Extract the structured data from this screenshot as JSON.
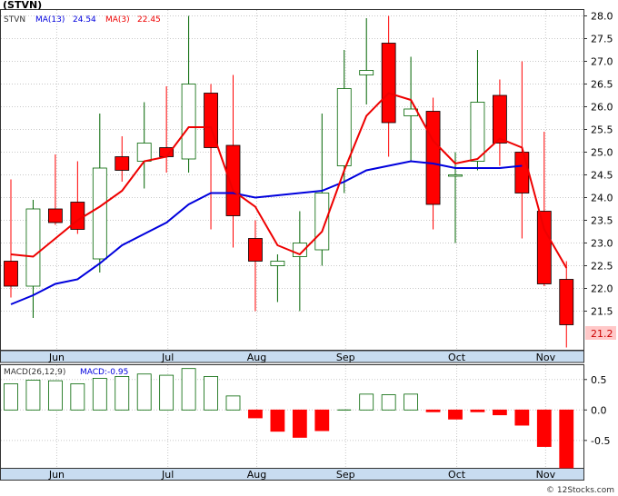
{
  "title": "(STVN)",
  "legend": {
    "symbol": "STVN",
    "ma13_label": "MA(13)",
    "ma13_value": "24.54",
    "ma3_label": "MA(3)",
    "ma3_value": "22.45"
  },
  "macd_legend": {
    "label": "MACD(26,12,9)",
    "value_label": "MACD:-0.95"
  },
  "last_price_label": "21.2",
  "watermark": "© 12Stocks.com",
  "colors": {
    "up": "#006400",
    "down": "#ff0000",
    "ma13": "#0000dd",
    "ma3": "#ee0000",
    "axis_band": "#c8dcf0",
    "price_tag": "#ffc8c8"
  },
  "chart_data": {
    "type": "candlestick",
    "price_axis": {
      "ticks": [
        "28.0",
        "27.5",
        "27.0",
        "26.5",
        "26.0",
        "25.5",
        "25.0",
        "24.5",
        "24.0",
        "23.5",
        "23.0",
        "22.5",
        "22.0",
        "21.5"
      ],
      "ylim": [
        20.65,
        28.15
      ]
    },
    "x_labels": [
      "Jun",
      "Jul",
      "Aug",
      "Sep",
      "Oct",
      "Nov"
    ],
    "x_label_index": [
      1,
      6,
      10,
      14,
      19,
      23
    ],
    "candles": [
      {
        "o": 22.6,
        "h": 24.4,
        "l": 21.8,
        "c": 22.05
      },
      {
        "o": 22.05,
        "h": 23.95,
        "l": 21.35,
        "c": 23.75
      },
      {
        "o": 23.75,
        "h": 24.95,
        "l": 23.4,
        "c": 23.45
      },
      {
        "o": 23.9,
        "h": 24.8,
        "l": 23.2,
        "c": 23.3
      },
      {
        "o": 22.65,
        "h": 25.85,
        "l": 22.35,
        "c": 24.65
      },
      {
        "o": 24.9,
        "h": 25.35,
        "l": 24.35,
        "c": 24.6
      },
      {
        "o": 24.8,
        "h": 26.1,
        "l": 24.2,
        "c": 25.2
      },
      {
        "o": 25.1,
        "h": 26.45,
        "l": 24.55,
        "c": 24.9
      },
      {
        "o": 24.85,
        "h": 28.0,
        "l": 24.55,
        "c": 26.5
      },
      {
        "o": 26.3,
        "h": 26.5,
        "l": 23.3,
        "c": 25.1
      },
      {
        "o": 25.15,
        "h": 26.7,
        "l": 22.9,
        "c": 23.6
      },
      {
        "o": 23.1,
        "h": 23.5,
        "l": 21.5,
        "c": 22.6
      },
      {
        "o": 22.5,
        "h": 22.75,
        "l": 21.7,
        "c": 22.6
      },
      {
        "o": 22.7,
        "h": 23.7,
        "l": 21.5,
        "c": 23.0
      },
      {
        "o": 22.85,
        "h": 25.85,
        "l": 22.5,
        "c": 24.1
      },
      {
        "o": 24.7,
        "h": 27.25,
        "l": 24.1,
        "c": 26.4
      },
      {
        "o": 26.7,
        "h": 27.95,
        "l": 26.05,
        "c": 26.8
      },
      {
        "o": 27.4,
        "h": 28.0,
        "l": 24.9,
        "c": 25.65
      },
      {
        "o": 25.8,
        "h": 27.1,
        "l": 24.8,
        "c": 25.95
      },
      {
        "o": 25.9,
        "h": 26.2,
        "l": 23.3,
        "c": 23.85
      },
      {
        "o": 24.5,
        "h": 25.0,
        "l": 23.0,
        "c": 24.5
      },
      {
        "o": 24.8,
        "h": 27.25,
        "l": 24.6,
        "c": 26.1
      },
      {
        "o": 26.25,
        "h": 26.6,
        "l": 24.7,
        "c": 25.2
      },
      {
        "o": 25.0,
        "h": 27.0,
        "l": 23.1,
        "c": 24.1
      },
      {
        "o": 23.7,
        "h": 25.45,
        "l": 22.05,
        "c": 22.1
      },
      {
        "o": 22.2,
        "h": 22.6,
        "l": 20.7,
        "c": 21.2
      }
    ],
    "ma13": [
      {
        "i": 0,
        "v": 21.65
      },
      {
        "i": 1,
        "v": 21.85
      },
      {
        "i": 2,
        "v": 22.1
      },
      {
        "i": 3,
        "v": 22.2
      },
      {
        "i": 4,
        "v": 22.55
      },
      {
        "i": 5,
        "v": 22.95
      },
      {
        "i": 6,
        "v": 23.2
      },
      {
        "i": 7,
        "v": 23.45
      },
      {
        "i": 8,
        "v": 23.85
      },
      {
        "i": 9,
        "v": 24.1
      },
      {
        "i": 10,
        "v": 24.1
      },
      {
        "i": 11,
        "v": 24.0
      },
      {
        "i": 12,
        "v": 24.05
      },
      {
        "i": 13,
        "v": 24.1
      },
      {
        "i": 14,
        "v": 24.15
      },
      {
        "i": 15,
        "v": 24.35
      },
      {
        "i": 16,
        "v": 24.6
      },
      {
        "i": 17,
        "v": 24.7
      },
      {
        "i": 18,
        "v": 24.8
      },
      {
        "i": 19,
        "v": 24.75
      },
      {
        "i": 20,
        "v": 24.65
      },
      {
        "i": 21,
        "v": 24.65
      },
      {
        "i": 22,
        "v": 24.65
      },
      {
        "i": 23,
        "v": 24.7
      }
    ],
    "ma3": [
      {
        "i": 0,
        "v": 22.75
      },
      {
        "i": 1,
        "v": 22.7
      },
      {
        "i": 2,
        "v": 23.1
      },
      {
        "i": 3,
        "v": 23.5
      },
      {
        "i": 4,
        "v": 23.8
      },
      {
        "i": 5,
        "v": 24.15
      },
      {
        "i": 6,
        "v": 24.8
      },
      {
        "i": 7,
        "v": 24.9
      },
      {
        "i": 8,
        "v": 25.55
      },
      {
        "i": 9,
        "v": 25.55
      },
      {
        "i": 10,
        "v": 24.15
      },
      {
        "i": 11,
        "v": 23.8
      },
      {
        "i": 12,
        "v": 22.95
      },
      {
        "i": 13,
        "v": 22.75
      },
      {
        "i": 14,
        "v": 23.25
      },
      {
        "i": 15,
        "v": 24.6
      },
      {
        "i": 16,
        "v": 25.8
      },
      {
        "i": 17,
        "v": 26.3
      },
      {
        "i": 18,
        "v": 26.15
      },
      {
        "i": 19,
        "v": 25.25
      },
      {
        "i": 20,
        "v": 24.75
      },
      {
        "i": 21,
        "v": 24.85
      },
      {
        "i": 22,
        "v": 25.3
      },
      {
        "i": 23,
        "v": 25.1
      },
      {
        "i": 24,
        "v": 23.3
      },
      {
        "i": 25,
        "v": 22.45
      }
    ],
    "macd": {
      "ticks": [
        "0.5",
        "0.0",
        "-0.5"
      ],
      "ylim": [
        -0.95,
        0.75
      ],
      "bars": [
        0.43,
        0.49,
        0.48,
        0.43,
        0.52,
        0.55,
        0.59,
        0.57,
        0.68,
        0.55,
        0.23,
        -0.13,
        -0.35,
        -0.45,
        -0.34,
        0.0,
        0.26,
        0.25,
        0.26,
        -0.03,
        -0.15,
        -0.03,
        -0.08,
        -0.25,
        -0.6,
        -0.95
      ]
    }
  }
}
